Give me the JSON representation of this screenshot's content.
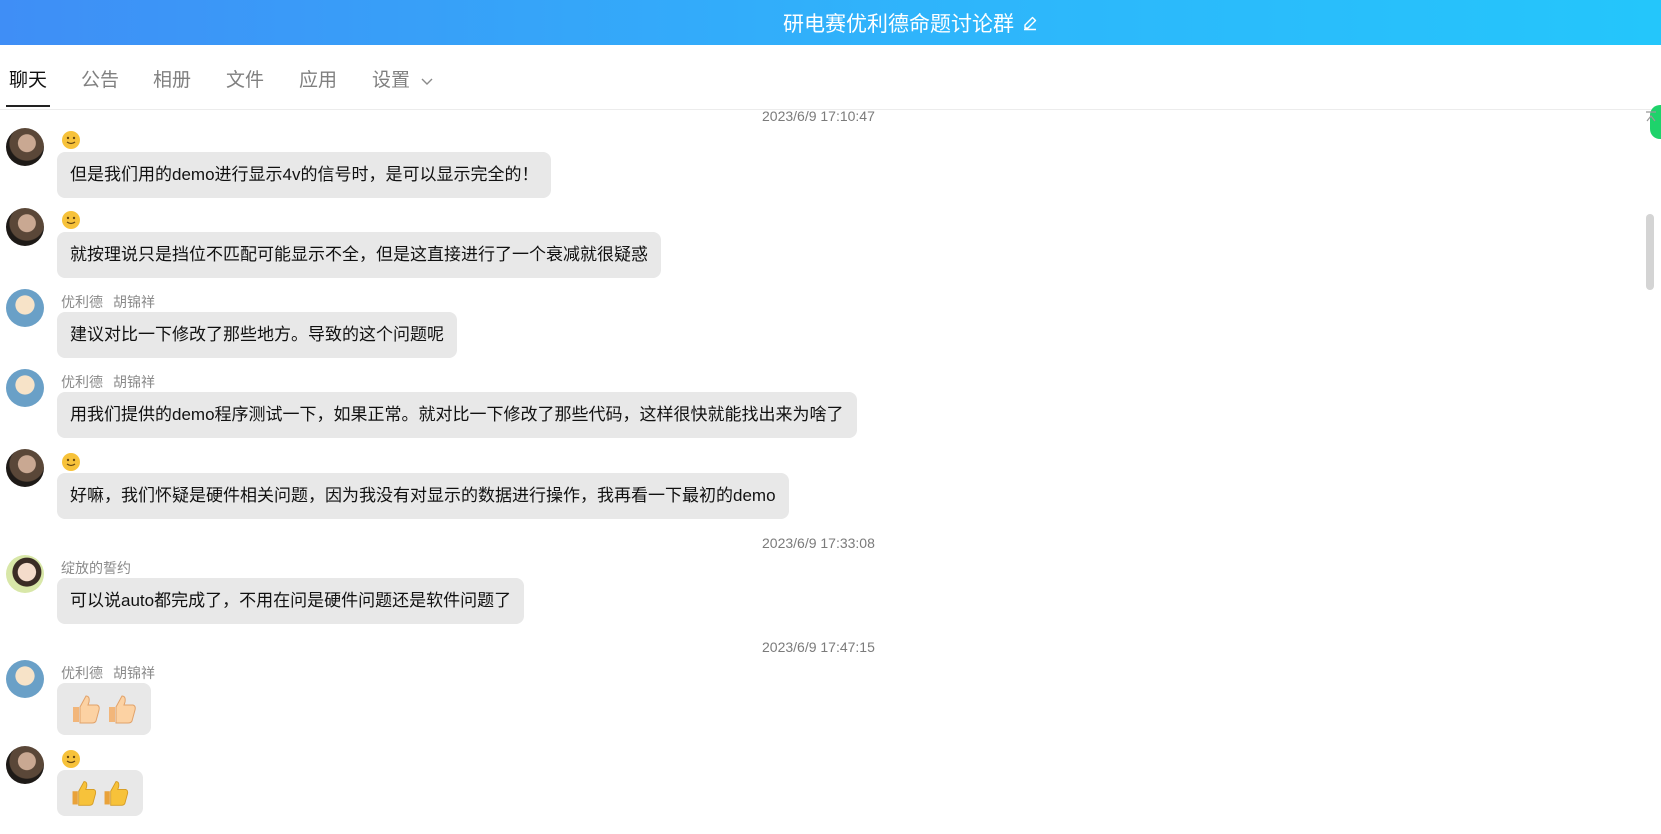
{
  "window": {
    "title": "研电赛优利德命题讨论群",
    "edit_icon": "edit-pencil-icon"
  },
  "tabs": [
    {
      "label": "聊天",
      "active": true
    },
    {
      "label": "公告"
    },
    {
      "label": "相册"
    },
    {
      "label": "文件"
    },
    {
      "label": "应用"
    },
    {
      "label": "设置",
      "has_dropdown": true
    }
  ],
  "timestamps": {
    "t1": "2023/6/9 17:10:47",
    "t2": "2023/6/9 17:33:08",
    "t3": "2023/6/9 17:47:15"
  },
  "senders": {
    "uni_tag": "优利德",
    "uni_name": "胡锦祥",
    "bloom": "绽放的誓约"
  },
  "messages": [
    {
      "text": "但是我们用的demo进行显示4v的信号时，是可以显示完全的！"
    },
    {
      "text": "就按理说只是挡位不匹配可能显示不全，但是这直接进行了一个衰减就很疑惑"
    },
    {
      "text": "建议对比一下修改了那些地方。导致的这个问题呢"
    },
    {
      "text": "用我们提供的demo程序测试一下，如果正常。就对比一下修改了那些代码，这样很快就能找出来为啥了"
    },
    {
      "text": "好嘛，我们怀疑是硬件相关问题，因为我没有对显示的数据进行操作，我再看一下最初的demo"
    },
    {
      "text": "可以说auto都完成了，不用在问是硬件问题还是软件问题了"
    },
    {
      "content": "thumbs-up-emoji x2"
    },
    {
      "content": "thumbs-up-emoji x2"
    }
  ],
  "colors": {
    "titlebar_start": "#3f8ef6",
    "titlebar_end": "#24c6fb",
    "bubble_bg": "#e8e8e8",
    "online_indicator": "#1ed36b"
  }
}
